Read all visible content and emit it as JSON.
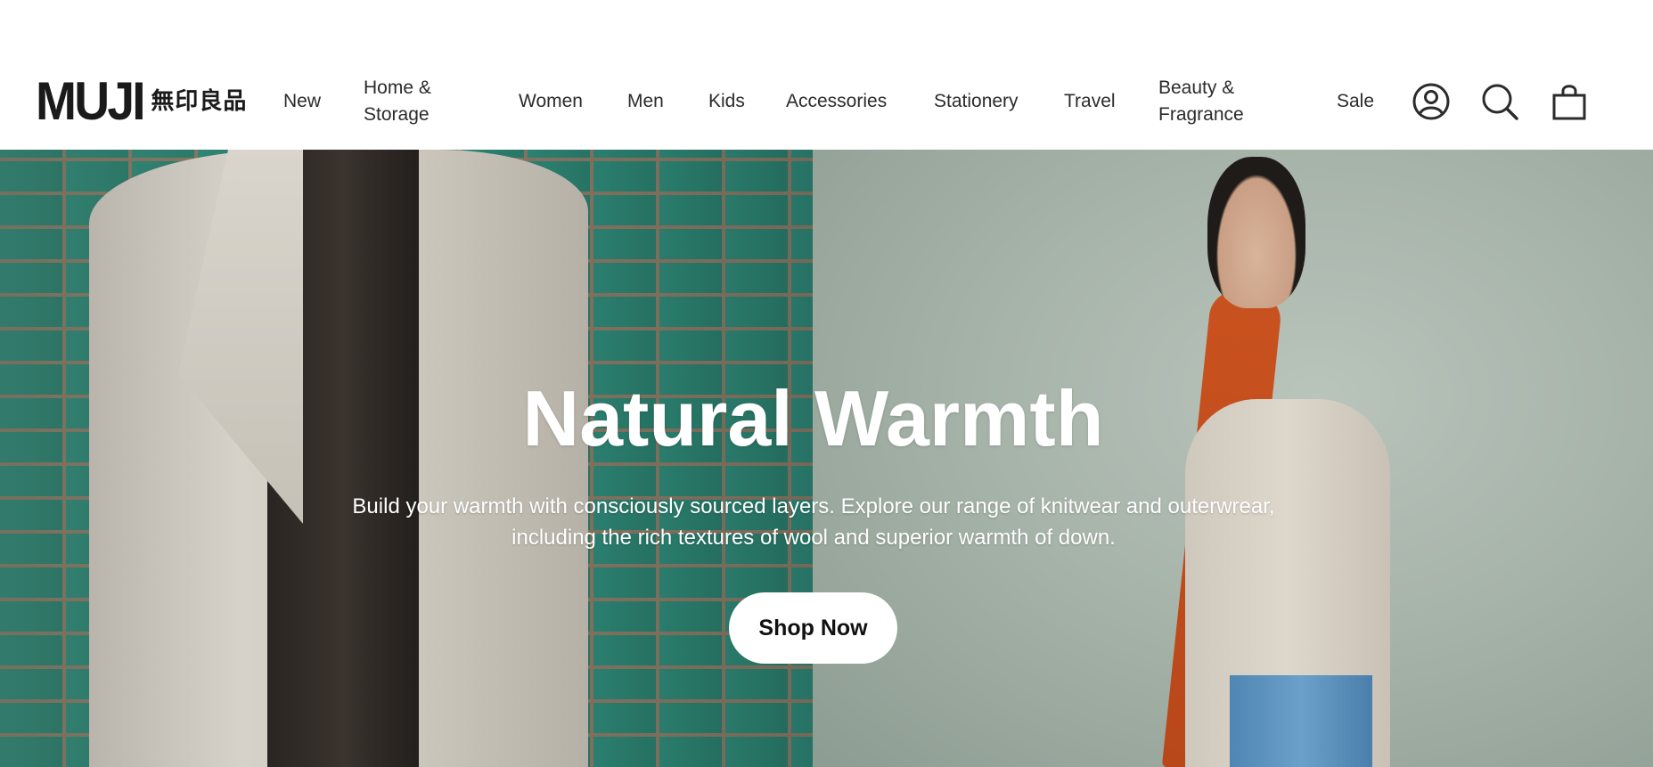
{
  "brand": {
    "logo_latin": "MUJI",
    "logo_kanji": "無印良品"
  },
  "nav": {
    "items": [
      {
        "label": "New"
      },
      {
        "label": "Home & Storage"
      },
      {
        "label": "Women"
      },
      {
        "label": "Men"
      },
      {
        "label": "Kids"
      },
      {
        "label": "Accessories"
      },
      {
        "label": "Stationery"
      },
      {
        "label": "Travel"
      },
      {
        "label": "Beauty & Fragrance"
      },
      {
        "label": "Sale"
      }
    ],
    "icons": [
      "account-icon",
      "search-icon",
      "bag-icon"
    ]
  },
  "hero": {
    "title": "Natural Warmth",
    "subtitle": "Build your warmth with consciously sourced layers. Explore our range of knitwear and outerwrear, including the rich textures of wool and superior warmth of down.",
    "cta_label": "Shop Now"
  },
  "colors": {
    "text": "#2b2b2b",
    "cta_bg": "#ffffff",
    "cta_text": "#111111",
    "tile_green": "#2f8a79",
    "scarf_orange": "#c9521f"
  }
}
